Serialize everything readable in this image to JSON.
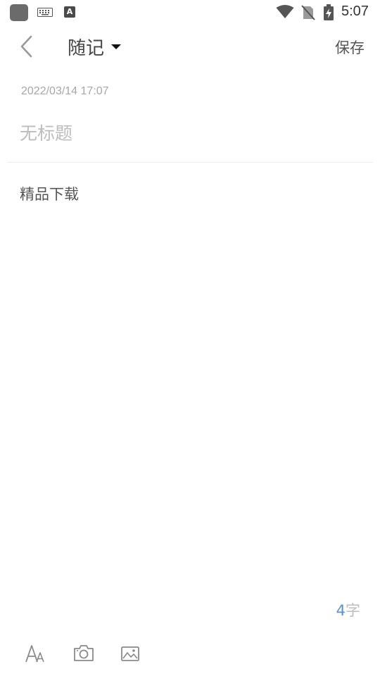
{
  "status_bar": {
    "time": "5:07",
    "notification_icon_letter": "A",
    "icons": [
      "app-square-icon",
      "keyboard-icon",
      "a-notification-icon",
      "wifi-icon",
      "no-sim-icon",
      "battery-charging-icon"
    ]
  },
  "header": {
    "back_icon": "chevron-left-icon",
    "title": "随记",
    "title_dropdown_icon": "caret-down-icon",
    "save_label": "保存"
  },
  "note": {
    "timestamp": "2022/03/14 17:07",
    "title_value": "",
    "title_placeholder": "无标题",
    "body": "精品下载"
  },
  "footer": {
    "char_count": "4",
    "char_unit": "字",
    "tools": [
      "font-size-icon",
      "camera-icon",
      "image-icon"
    ]
  },
  "colors": {
    "accent": "#5b8fd6",
    "placeholder": "#bdbdbd",
    "text": "#555555"
  }
}
